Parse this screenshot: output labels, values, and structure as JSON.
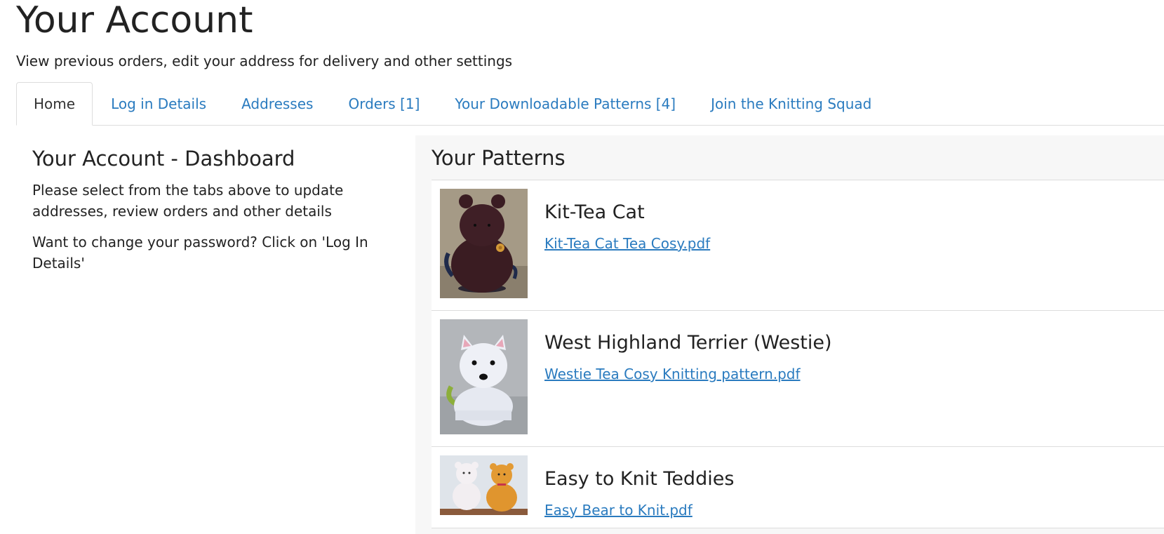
{
  "header": {
    "title": "Your Account",
    "subtitle": "View previous orders, edit your address for delivery and other settings"
  },
  "tabs": [
    {
      "label": "Home",
      "active": true
    },
    {
      "label": "Log in Details",
      "active": false
    },
    {
      "label": "Addresses",
      "active": false
    },
    {
      "label": "Orders [1]",
      "active": false
    },
    {
      "label": "Your Downloadable Patterns [4]",
      "active": false
    },
    {
      "label": "Join the Knitting Squad",
      "active": false
    }
  ],
  "dashboard": {
    "title": "Your Account - Dashboard",
    "text1": "Please select from the tabs above to update addresses, review orders and other details",
    "text2": "Want to change your password? Click on 'Log In Details'"
  },
  "patterns": {
    "title": "Your Patterns",
    "items": [
      {
        "name": "Kit-Tea Cat",
        "file": "Kit-Tea Cat Tea Cosy.pdf",
        "image": "kit-tea-cat-photo"
      },
      {
        "name": "West Highland Terrier (Westie)",
        "file": "Westie Tea Cosy Knitting pattern.pdf",
        "image": "westie-photo"
      },
      {
        "name": "Easy to Knit Teddies",
        "file": "Easy Bear to Knit.pdf",
        "image": "teddies-photo"
      }
    ]
  },
  "colors": {
    "link": "#2a7bbf",
    "border": "#dddddd",
    "panel_bg": "#f7f7f7"
  }
}
